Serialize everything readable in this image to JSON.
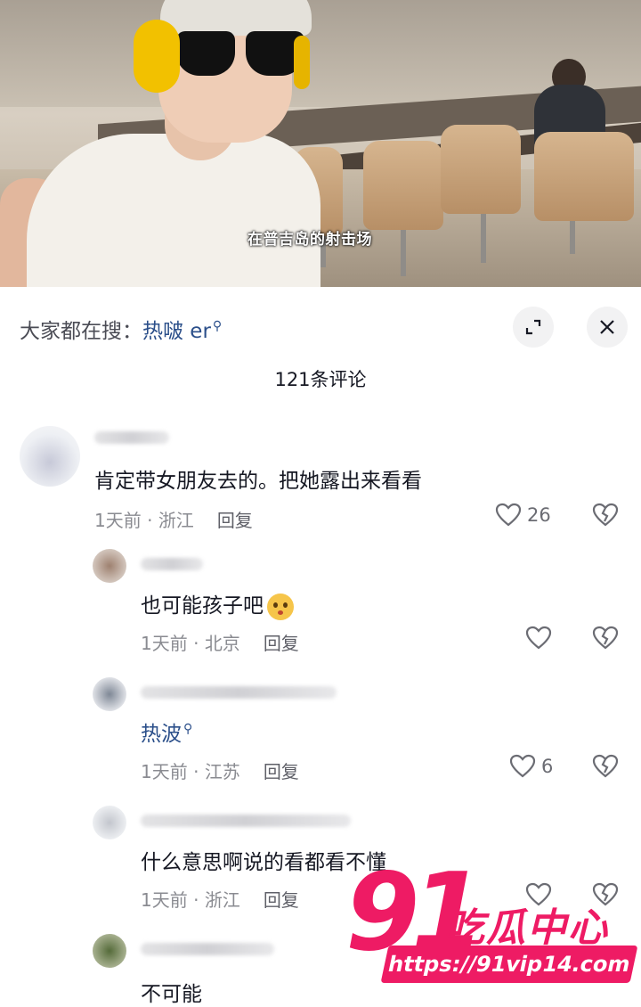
{
  "video": {
    "caption": "在普吉岛的射击场"
  },
  "header": {
    "search_prefix": "大家都在搜：",
    "search_keyword": "热啵 er",
    "comment_count_title": "121条评论",
    "expand_icon": "expand-icon",
    "close_icon": "close-icon"
  },
  "comments": [
    {
      "text": "肯定带女朋友去的。把她露出来看看",
      "time": "1天前",
      "location": "浙江",
      "reply_label": "回复",
      "likes": "26"
    },
    {
      "text": "也可能孩子吧",
      "emoji": "thinking-face-emoji",
      "time": "1天前",
      "location": "北京",
      "reply_label": "回复",
      "likes": ""
    },
    {
      "text": "热波",
      "time": "1天前",
      "location": "江苏",
      "reply_label": "回复",
      "likes": "6"
    },
    {
      "text": "什么意思啊说的看都看不懂",
      "time": "1天前",
      "location": "浙江",
      "reply_label": "回复",
      "likes": ""
    },
    {
      "text": "不可能"
    }
  ],
  "watermark": {
    "number": "91",
    "brand": "吃瓜中心",
    "url": "https://91vip14.com"
  },
  "colors": {
    "link": "#2b4f8a",
    "watermark": "#ee1b64",
    "meta_text": "#8a8b91"
  }
}
